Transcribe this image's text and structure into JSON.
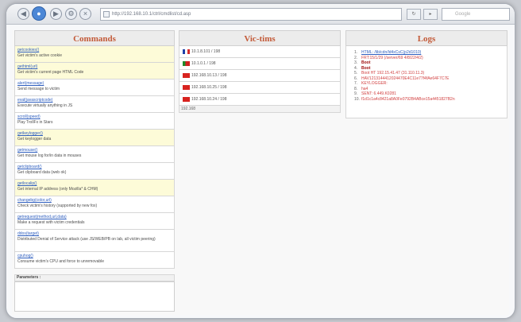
{
  "browser": {
    "url": "http://192.168.10.1/ctrl/cmdlist/cd.asp",
    "search_placeholder": "Google",
    "refresh_label": "↻",
    "go_label": "▸",
    "back_glyph": "◀",
    "forward_glyph": "▶"
  },
  "commands": {
    "title": "Commands",
    "items": [
      {
        "name": "getcookies()",
        "desc": "Get victim's active cookie",
        "highlight": true
      },
      {
        "name": "gethtml(url)",
        "desc": "Get victim's current page HTML Code",
        "highlight": true
      },
      {
        "name": "alert(message)",
        "desc": "Send message to victim",
        "highlight": false
      },
      {
        "name": "eval(javascriptcode)",
        "desc": "Execute virtually anything in JS",
        "highlight": false
      },
      {
        "name": "scroll(speed)",
        "desc": "Play TrollFx in Stars",
        "highlight": false
      },
      {
        "name": "getkeylogger()",
        "desc": "Get keylogger data",
        "highlight": true
      },
      {
        "name": "getmouse()",
        "desc": "Get mouse log for/in data in mouses",
        "highlight": false
      },
      {
        "name": "getclipboard()",
        "desc": "Get clipboard data (web ok)",
        "highlight": false
      },
      {
        "name": "getlocalip()",
        "desc": "Get internal IP address (only Mozilla* & CHM)",
        "highlight": true
      },
      {
        "name": "changebg(color,url)",
        "desc": "Check victim's history (supported by new fox)",
        "highlight": false
      },
      {
        "name": "getrequest(method,url,data)",
        "desc": "Make a request with victim credentials",
        "highlight": false
      },
      {
        "name": "ddos(target)",
        "desc": "Distributed Denial of Service attack (use JS/WEB/PB on lab, all victim peering)",
        "highlight": false,
        "tall": true
      },
      {
        "name": "cpuhog()",
        "desc": "Consume victim's CPU and force to unremovable",
        "highlight": false
      }
    ],
    "parameters_label": "Parameters :"
  },
  "vms": {
    "title": "Vic-tims",
    "items": [
      {
        "flag": "fr",
        "address": "10.1.8.101",
        "suffix": "/ 198"
      },
      {
        "flag": "pt",
        "address": "10.1.0.1",
        "suffix": "/ 198"
      },
      {
        "flag": "cn",
        "address": "192.168.10.13",
        "suffix": "/ 198"
      },
      {
        "flag": "cn",
        "address": "192.168.10.25",
        "suffix": "/ 198"
      },
      {
        "flag": "cn",
        "address": "192.168.10.24",
        "suffix": "/ 198"
      }
    ],
    "count": "192.168"
  },
  "logs": {
    "title": "Logs",
    "items": [
      {
        "n": "1.",
        "text": "HTML: /lib/cdn/ld4xCsC(p2d1010)",
        "style": "blue"
      },
      {
        "n": "2.",
        "text": "FRT:15/1/29 (/server/69 4/8/22/4/2)",
        "style": "red"
      },
      {
        "n": "3.",
        "text": "Boot",
        "style": "darkred"
      },
      {
        "n": "4.",
        "text": "Boot",
        "style": "darkred"
      },
      {
        "n": "5.",
        "text": "Boot HT 192.15.41.47 (31.110.11.3)",
        "style": "red"
      },
      {
        "n": "6.",
        "text": "HAV1213144412024470E4C11e77f4fAe64F7C7E",
        "style": "red"
      },
      {
        "n": "7.",
        "text": "KEYLOGGER:",
        "style": "red"
      },
      {
        "n": "8.",
        "text": "ha4",
        "style": "red"
      },
      {
        "n": "9.",
        "text": "SENT: 6.449.K0281",
        "style": "red"
      },
      {
        "n": "10.",
        "text": "f1d1c1a4c8421a8A0Fe0792B4ABce15a4451827B2n",
        "style": "red"
      }
    ]
  }
}
